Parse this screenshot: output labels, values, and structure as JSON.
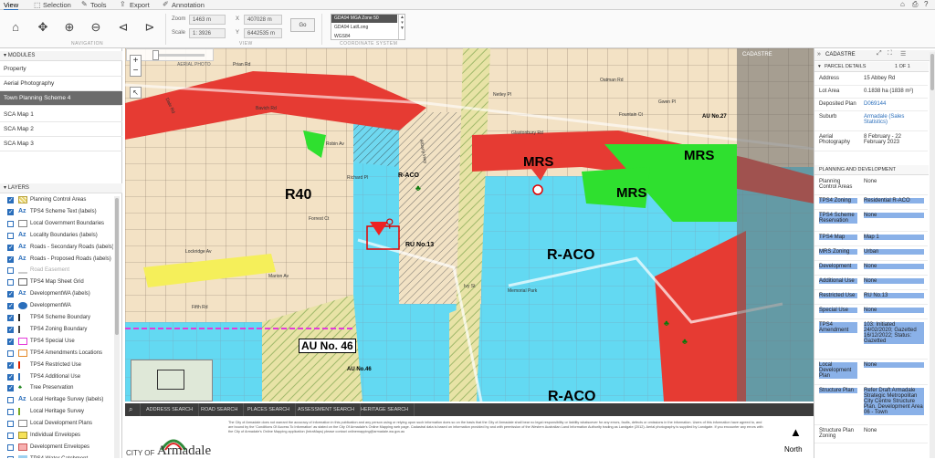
{
  "tabs": [
    {
      "label": "View",
      "active": true
    },
    {
      "label": "Selection"
    },
    {
      "label": "Tools"
    },
    {
      "label": "Export"
    },
    {
      "label": "Annotation"
    }
  ],
  "ribbon": {
    "navigation_label": "NAVIGATION",
    "view_label": "VIEW",
    "coord_label": "COORDINATE SYSTEM",
    "zoom_label": "Zoom",
    "zoom_value": "1463 m",
    "scale_label": "Scale",
    "scale_value": "1: 3926",
    "x_label": "X",
    "x_value": "407028 m",
    "y_label": "Y",
    "y_value": "6442535 m",
    "go_label": "Go",
    "coord_options": [
      "GDA94 MGA Zone 50",
      "GDA94 Lat/Long",
      "WGS84"
    ]
  },
  "modules": {
    "header": "MODULES",
    "items": [
      "Property",
      "Aerial Photography",
      "Town Planning Scheme 4",
      "SCA Map 1",
      "SCA Map 2",
      "SCA Map 3"
    ],
    "selected": 2
  },
  "layers": {
    "header": "LAYERS",
    "items": [
      {
        "label": "Planning Control Areas",
        "on": true
      },
      {
        "label": "TPS4 Scheme Text (labels)",
        "on": true
      },
      {
        "label": "Local Government Boundaries",
        "on": false
      },
      {
        "label": "Locality Boundaries (labels)",
        "on": false
      },
      {
        "label": "Roads - Secondary Roads (labels)",
        "on": true
      },
      {
        "label": "Roads - Proposed Roads (labels)",
        "on": true
      },
      {
        "label": "Road Easement",
        "on": false
      },
      {
        "label": "TPS4 Map Sheet Grid",
        "on": false
      },
      {
        "label": "DevelopmentWA (labels)",
        "on": true
      },
      {
        "label": "DevelopmentWA",
        "on": true
      },
      {
        "label": "TPS4 Scheme Boundary",
        "on": true
      },
      {
        "label": "TPS4 Zoning Boundary",
        "on": true
      },
      {
        "label": "TPS4 Special Use",
        "on": true
      },
      {
        "label": "TPS4 Amendments Locations",
        "on": false
      },
      {
        "label": "TPS4 Restricted Use",
        "on": true
      },
      {
        "label": "TPS4 Additional Use",
        "on": true
      },
      {
        "label": "Tree Preservation",
        "on": true
      },
      {
        "label": "Local Heritage Survey (labels)",
        "on": false
      },
      {
        "label": "Local Heritage Survey",
        "on": false
      },
      {
        "label": "Local Development Plans",
        "on": false
      },
      {
        "label": "Individual Envelopes",
        "on": false
      },
      {
        "label": "Development Envelopes",
        "on": false
      },
      {
        "label": "TPS4 Water Catchment",
        "on": false
      }
    ]
  },
  "map": {
    "aerial_photo_label": "AERIAL PHOTO",
    "cadastre_label": "CADASTRE",
    "zones": [
      "R40",
      "MRS",
      "MRS",
      "MRS",
      "R-ACO",
      "R-ACO",
      "R-ACO",
      "AU No. 46",
      "AU No.46",
      "RU No.13",
      "AU No.27"
    ],
    "streets": [
      "Prian Rd",
      "Bavich Rd",
      "Dale Rd",
      "Lockridge Av",
      "Robin Av",
      "Richard Pl",
      "Marion Av",
      "Fifth Rd",
      "Forrest Ct",
      "Netley Pl",
      "Oatman Rd",
      "Fountain Ct",
      "Gwen Pl",
      "Glastonbury Rd",
      "Albany Hwy",
      "Memorial Park",
      "Ivy St"
    ]
  },
  "search_tabs": [
    "ADDRESS SEARCH",
    "ROAD SEARCH",
    "PLACES SEARCH",
    "ASSESSMENT SEARCH",
    "HERITAGE SEARCH"
  ],
  "footer": {
    "logo_pre": "CITY OF",
    "logo_name": "Armadale",
    "north": "North",
    "disclaimer": "The City of Armadale does not warrant the accuracy of information in this publication and any person using or relying upon such information does so on the basis that the City of Armadale shall bear no legal responsibility or liability whatsoever for any errors, faults, defects or omissions in the information. Users of this information have agreed to, and are bound by the 'Conditions Of Access To Information' as stated on the City Of Armadale's Online Mapping web page. Cadastral data is based on information provided by and with permission of the Western Australian Land Information Authority trading as Landgate (2012). Aerial photography is supplied by Landgate. If you encounter any errors with the City of Armadale's Online Mapping application (IntraMaps) please contact onlinemapping@armadale.wa.gov.au"
  },
  "panel": {
    "title": "CADASTRE",
    "section": "PARCEL DETAILS",
    "pager": "1 OF 1",
    "planning_header": "PLANNING AND DEVELOPMENT",
    "parcel": [
      {
        "k": "Address",
        "v": "15 Abbey Rd"
      },
      {
        "k": "Lot Area",
        "v": "0.1838 ha (1838 m²)"
      },
      {
        "k": "Deposited Plan",
        "v": "D069144",
        "link": true
      },
      {
        "k": "Suburb",
        "v": "Armadale (Sales Statistics)",
        "link": true
      },
      {
        "k": "Aerial Photography",
        "v": "8 February - 22 February 2023"
      }
    ],
    "planning": [
      {
        "k": "Planning Control Areas",
        "v": "None"
      },
      {
        "k": "TPS4 Zoning",
        "v": "Residential R-ACO"
      },
      {
        "k": "TPS4 Scheme Reservation",
        "v": "None"
      },
      {
        "k": "TPS4 Map",
        "v": "Map 1"
      },
      {
        "k": "MRS Zoning",
        "v": "Urban"
      },
      {
        "k": "Development",
        "v": "None"
      },
      {
        "k": "Additional Use",
        "v": "None"
      },
      {
        "k": "Restricted Use",
        "v": "RU No.13"
      },
      {
        "k": "Special Use",
        "v": "None"
      },
      {
        "k": "TPS4 Amendment",
        "v": "103: Initiated 24/02/2020; Gazetted 16/12/2022; Status: Gazetted"
      },
      {
        "k": "Local Development Plan",
        "v": "None"
      },
      {
        "k": "Structure Plan",
        "v": "Refer Draft Armadale Strategic Metropolitan City Centre Structure Plan. Development Area 06 - Town"
      },
      {
        "k": "Structure Plan Zoning",
        "v": "None"
      }
    ]
  }
}
